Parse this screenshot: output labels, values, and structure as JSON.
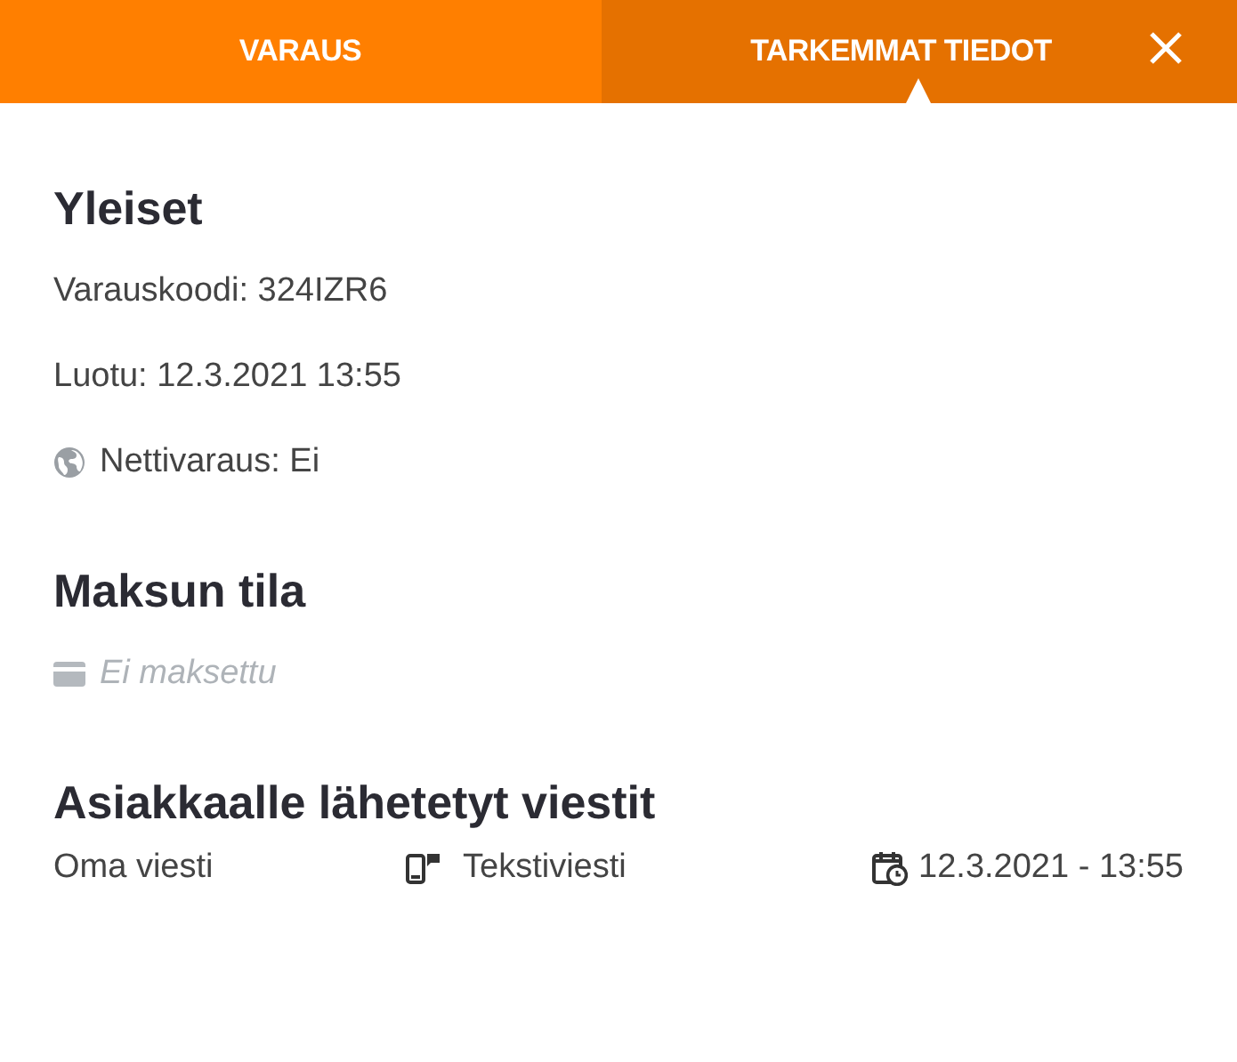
{
  "tabs": [
    {
      "label": "VARAUS",
      "selected": false
    },
    {
      "label": "TARKEMMAT TIEDOT",
      "selected": true
    }
  ],
  "sections": [
    {
      "title": "Yleiset",
      "lines": [
        {
          "kind": "text",
          "text": "Varauskoodi: 324IZR6"
        },
        {
          "kind": "text",
          "text": "Luotu: 12.3.2021 13:55"
        },
        {
          "kind": "globe",
          "text": "Nettivaraus: Ei"
        }
      ]
    },
    {
      "title": "Maksun tila",
      "lines": [
        {
          "kind": "payment",
          "text": "Ei maksettu",
          "paid": false
        }
      ]
    }
  ],
  "messages": {
    "title": "Asiakkaalle lähetetyt viestit",
    "rows": [
      {
        "name": "Oma viesti",
        "type": "Tekstiviesti",
        "sent": "12.3.2021 - 13:55"
      }
    ]
  }
}
